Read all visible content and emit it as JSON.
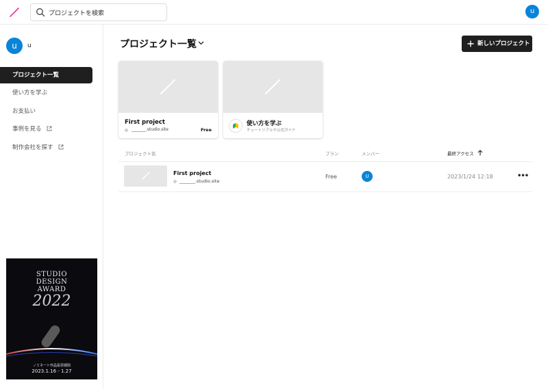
{
  "search": {
    "placeholder": "プロジェクトを検索"
  },
  "account": {
    "avatar_letter": "u"
  },
  "sidebar": {
    "user_letter": "u",
    "user_name": "u",
    "items": [
      {
        "label": "プロジェクト一覧",
        "active": true,
        "external": false
      },
      {
        "label": "使い方を学ぶ",
        "active": false,
        "external": false
      },
      {
        "label": "お支払い",
        "active": false,
        "external": false
      },
      {
        "label": "事例を見る",
        "active": false,
        "external": true
      },
      {
        "label": "制作会社を探す",
        "active": false,
        "external": true
      }
    ],
    "banner": {
      "line1": "STUDIO",
      "line2": "DESIGN",
      "line3": "AWARD",
      "year": "2022",
      "bottom_line1": "ノミネート作品投票期間",
      "bottom_line2": "2023.1.16 - 1.27"
    }
  },
  "main": {
    "title": "プロジェクト一覧",
    "new_button": "新しいプロジェクト",
    "cards": {
      "project": {
        "name": "First project",
        "domain": "_______.studio.site",
        "plan": "Free"
      },
      "learn": {
        "title": "使い方を学ぶ",
        "subtitle": "チュートリアルや公式ガイド"
      }
    },
    "table": {
      "headers": {
        "name": "プロジェクト名",
        "plan": "プラン",
        "members": "メンバー",
        "last_access": "最終アクセス"
      },
      "rows": [
        {
          "name": "First project",
          "domain": "_______.studio.site",
          "plan": "Free",
          "member_letter": "U",
          "last_access": "2023/1/24 12:18",
          "more": "•••"
        }
      ]
    }
  },
  "colors": {
    "accent": "#e8359a",
    "avatar": "#0a84d8",
    "dark_button": "#1f1f1f"
  }
}
